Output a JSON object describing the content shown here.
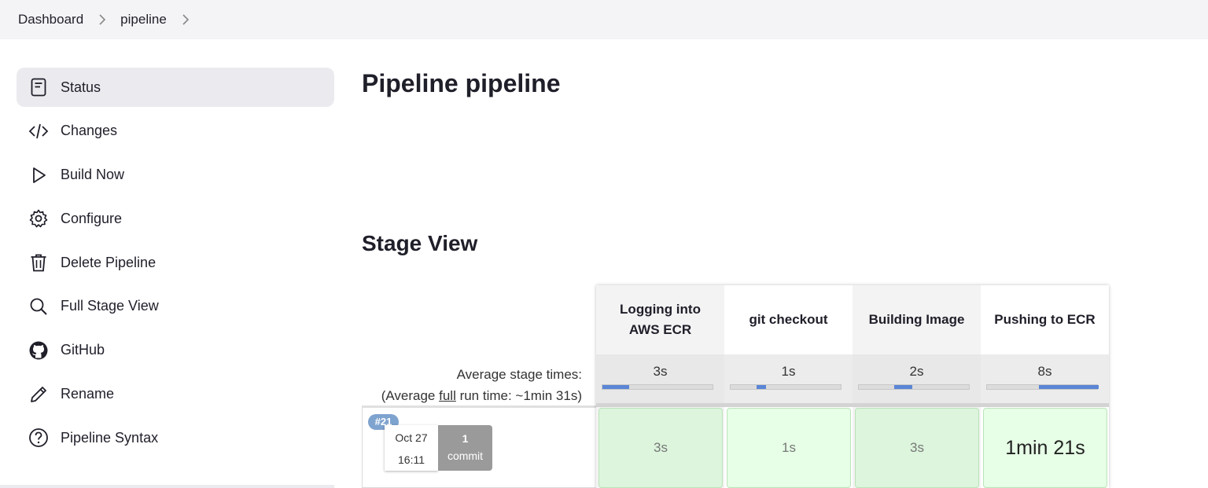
{
  "breadcrumb": [
    {
      "label": "Dashboard"
    },
    {
      "label": "pipeline"
    }
  ],
  "sidebar": {
    "items": [
      {
        "label": "Status",
        "icon": "document-icon",
        "active": true
      },
      {
        "label": "Changes",
        "icon": "code-icon"
      },
      {
        "label": "Build Now",
        "icon": "play-icon"
      },
      {
        "label": "Configure",
        "icon": "gear-icon"
      },
      {
        "label": "Delete Pipeline",
        "icon": "trash-icon"
      },
      {
        "label": "Full Stage View",
        "icon": "search-icon"
      },
      {
        "label": "GitHub",
        "icon": "github-icon"
      },
      {
        "label": "Rename",
        "icon": "pencil-icon"
      },
      {
        "label": "Pipeline Syntax",
        "icon": "help-icon"
      }
    ]
  },
  "main": {
    "title": "Pipeline pipeline",
    "stage_view_title": "Stage View"
  },
  "stage_view": {
    "average_label": "Average stage times:",
    "full_run_prefix": "(Average ",
    "full_run_link": "full",
    "full_run_suffix": " run time: ~1min 31s)",
    "stages": [
      {
        "name": "Logging into AWS ECR",
        "avg": "3s"
      },
      {
        "name": "git checkout",
        "avg": "1s"
      },
      {
        "name": "Building Image",
        "avg": "2s"
      },
      {
        "name": "Pushing to ECR",
        "avg": "8s"
      }
    ],
    "runs": [
      {
        "build": "#21",
        "date": "Oct 27",
        "time": "16:11",
        "commit_count": "1",
        "commit_label": "commit",
        "durations": [
          "3s",
          "1s",
          "3s",
          "1min 21s"
        ]
      }
    ]
  },
  "colors": {
    "success_cell_dark": "#dcf5dc",
    "success_cell_light": "#e6ffe6",
    "progress_fill": "#5b86d6",
    "build_badge": "#7ea3cf"
  }
}
